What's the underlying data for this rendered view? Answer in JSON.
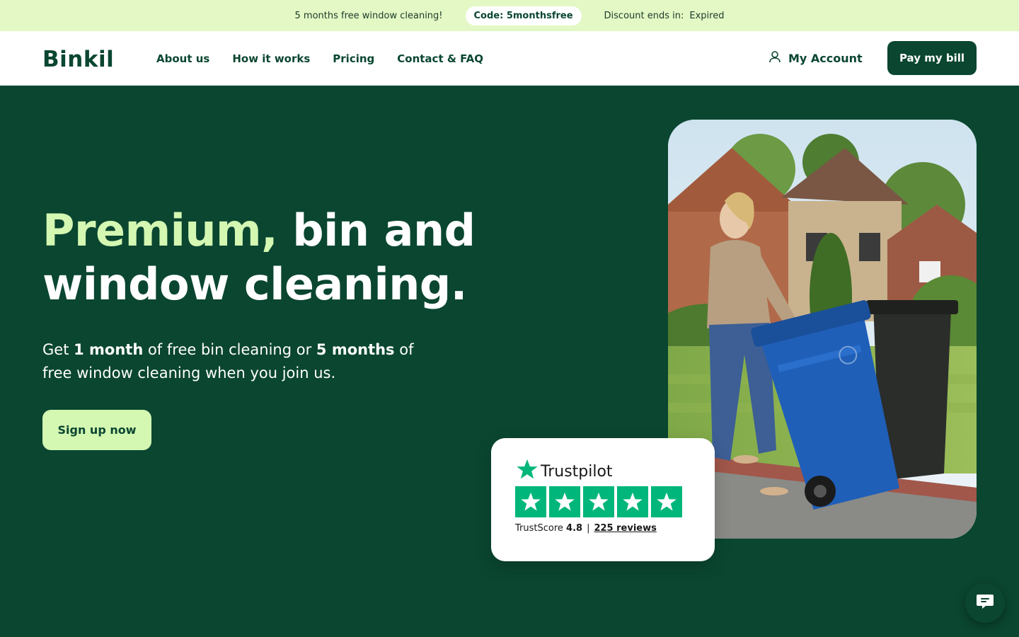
{
  "promo": {
    "offer_text": "5 months free window cleaning!",
    "code_label": "Code: 5monthsfree",
    "ends_label": "Discount ends in:",
    "ends_value": "Expired"
  },
  "header": {
    "logo": "Binkil",
    "nav": [
      "About us",
      "How it works",
      "Pricing",
      "Contact & FAQ"
    ],
    "account_label": "My Account",
    "pay_label": "Pay my bill"
  },
  "hero": {
    "title_accent": "Premium,",
    "title_rest": " bin and window cleaning.",
    "sub_part1": "Get ",
    "sub_bold1": "1 month",
    "sub_part2": " of free bin cleaning or ",
    "sub_bold2": "5 months",
    "sub_part3": " of free window cleaning when you join us.",
    "cta": "Sign up now"
  },
  "trustpilot": {
    "brand": "Trustpilot",
    "score_label": "TrustScore",
    "score": "4.8",
    "separator": "|",
    "reviews": "225 reviews",
    "rating_stars": 5
  },
  "icons": {
    "account": "user-icon",
    "trustpilot": "star-icon",
    "chat": "chat-bubble-icon"
  },
  "colors": {
    "brand_green": "#0a4630",
    "accent_lime": "#d4f7b2",
    "promo_bg": "#e3f8c4",
    "trustpilot_green": "#00b67a"
  }
}
